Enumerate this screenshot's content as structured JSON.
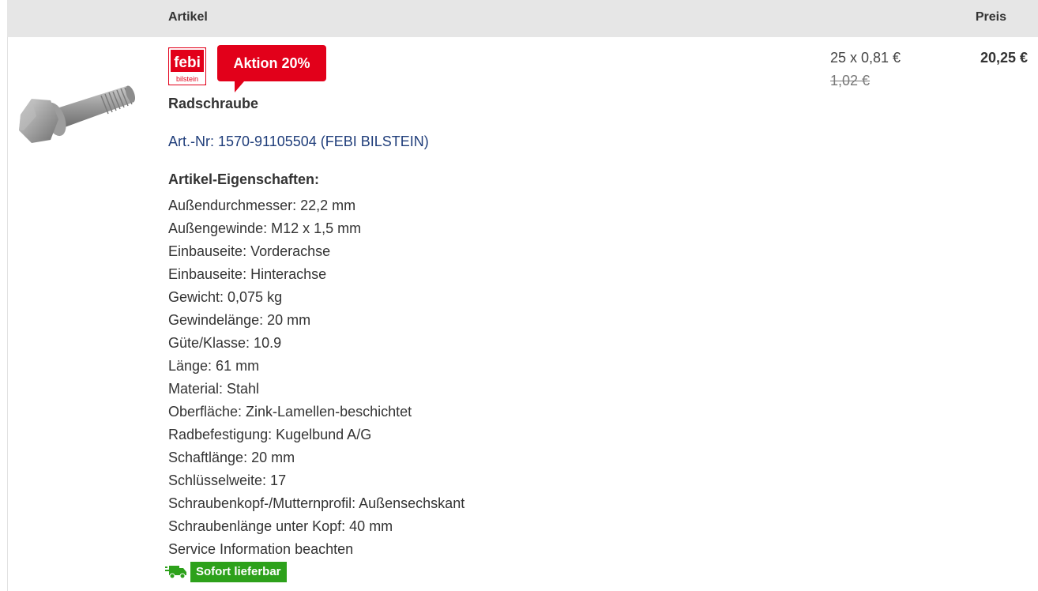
{
  "header": {
    "article_label": "Artikel",
    "price_label": "Preis"
  },
  "product": {
    "brand_logo_text": "febi",
    "brand_logo_subtext": "bilstein",
    "promo_badge": "Aktion 20%",
    "title": "Radschraube",
    "article_number": "Art.-Nr: 1570-91105504 (FEBI BILSTEIN)",
    "properties_heading": "Artikel-Eigenschaften:",
    "properties": [
      "Außendurchmesser: 22,2 mm",
      "Außengewinde: M12 x 1,5 mm",
      "Einbauseite: Vorderachse",
      "Einbauseite: Hinterachse",
      "Gewicht: 0,075 kg",
      "Gewindelänge: 20 mm",
      "Güte/Klasse: 10.9",
      "Länge: 61 mm",
      "Material: Stahl",
      "Oberfläche: Zink-Lamellen-beschichtet",
      "Radbefestigung: Kugelbund A/G",
      "Schaftlänge: 20 mm",
      "Schlüsselweite: 17",
      "Schraubenkopf-/Mutternprofil: Außensechskant",
      "Schraubenlänge unter Kopf: 40 mm",
      "Service Information beachten"
    ],
    "availability": "Sofort lieferbar",
    "availability_icon": "truck-icon"
  },
  "pricing": {
    "unit_price": "25 x 0,81 €",
    "old_price": "1,02 €",
    "total_price": "20,25 €"
  },
  "colors": {
    "promo": "#e2001a",
    "availability": "#2da11b",
    "link": "#1f3d7a",
    "header_bg": "#e6e6e6"
  }
}
